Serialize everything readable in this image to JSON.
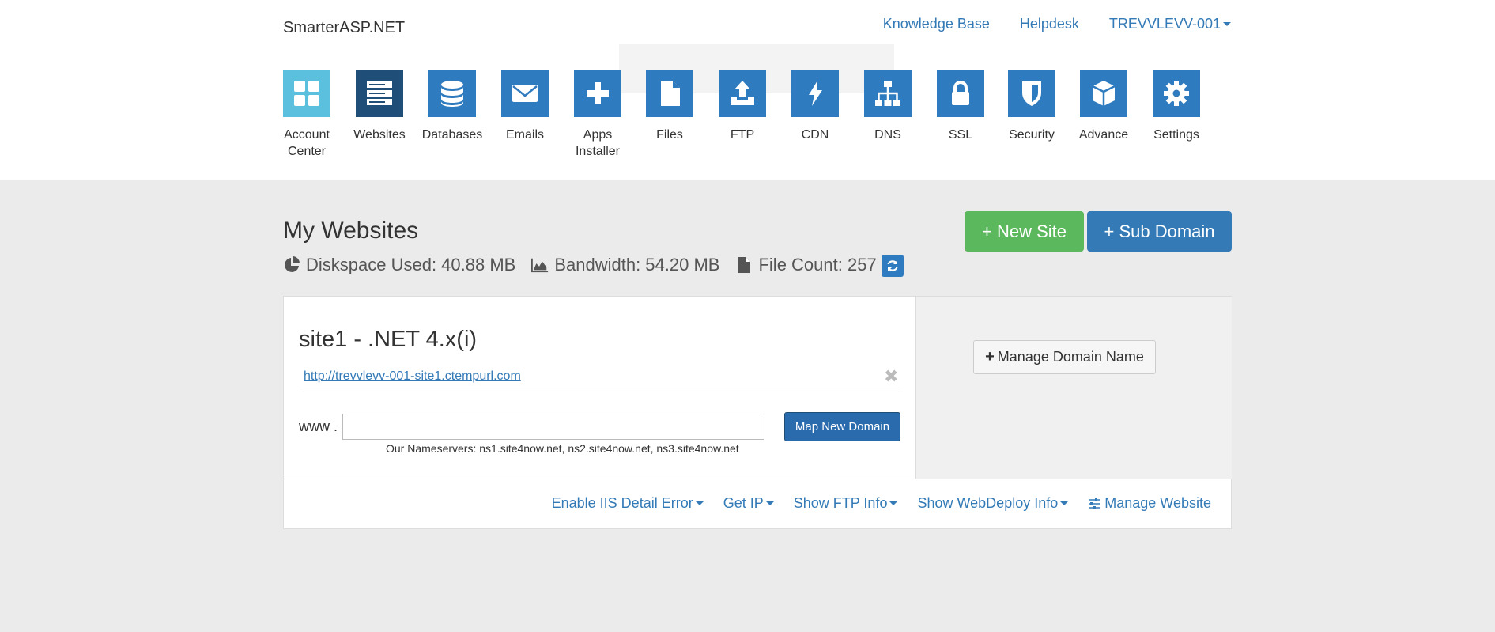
{
  "brand": "SmarterASP.NET",
  "toplinks": {
    "kb": "Knowledge Base",
    "helpdesk": "Helpdesk",
    "account": "TREVVLEVV-001"
  },
  "nav": [
    {
      "label": "Account Center",
      "icon": "grid-icon",
      "color": "#5bc0de"
    },
    {
      "label": "Websites",
      "icon": "server-icon",
      "color": "#1f4e79"
    },
    {
      "label": "Databases",
      "icon": "database-icon",
      "color": "#2f7bbf"
    },
    {
      "label": "Emails",
      "icon": "envelope-icon",
      "color": "#2f7bbf"
    },
    {
      "label": "Apps Installer",
      "icon": "plus-icon",
      "color": "#2f7bbf"
    },
    {
      "label": "Files",
      "icon": "file-icon",
      "color": "#2f7bbf"
    },
    {
      "label": "FTP",
      "icon": "upload-icon",
      "color": "#2f7bbf"
    },
    {
      "label": "CDN",
      "icon": "bolt-icon",
      "color": "#2f7bbf"
    },
    {
      "label": "DNS",
      "icon": "sitemap-icon",
      "color": "#2f7bbf"
    },
    {
      "label": "SSL",
      "icon": "lock-icon",
      "color": "#2f7bbf"
    },
    {
      "label": "Security",
      "icon": "shield-icon",
      "color": "#2f7bbf"
    },
    {
      "label": "Advance",
      "icon": "cube-icon",
      "color": "#2f7bbf"
    },
    {
      "label": "Settings",
      "icon": "gear-icon",
      "color": "#2f7bbf"
    }
  ],
  "page": {
    "title": "My Websites",
    "diskspace": "Diskspace Used: 40.88 MB",
    "bandwidth": "Bandwidth: 54.20 MB",
    "filecount": "File Count: 257",
    "new_site": "+ New Site",
    "sub_domain": "+ Sub Domain"
  },
  "site": {
    "title": "site1 - .NET 4.x(i)",
    "url": "http://trevvlevv-001-site1.ctempurl.com",
    "www": "www .",
    "domain_value": "",
    "map_button": "Map New Domain",
    "nameservers": "Our Nameservers: ns1.site4now.net, ns2.site4now.net, ns3.site4now.net",
    "manage_domain": "Manage Domain Name"
  },
  "footer_links": {
    "iis": "Enable IIS Detail Error",
    "ip": "Get IP",
    "ftp": "Show FTP Info",
    "webdeploy": "Show WebDeploy Info",
    "manage": "Manage Website"
  },
  "colors": {
    "primary": "#337ab7",
    "success": "#5cb85c",
    "background": "#ebebeb"
  }
}
